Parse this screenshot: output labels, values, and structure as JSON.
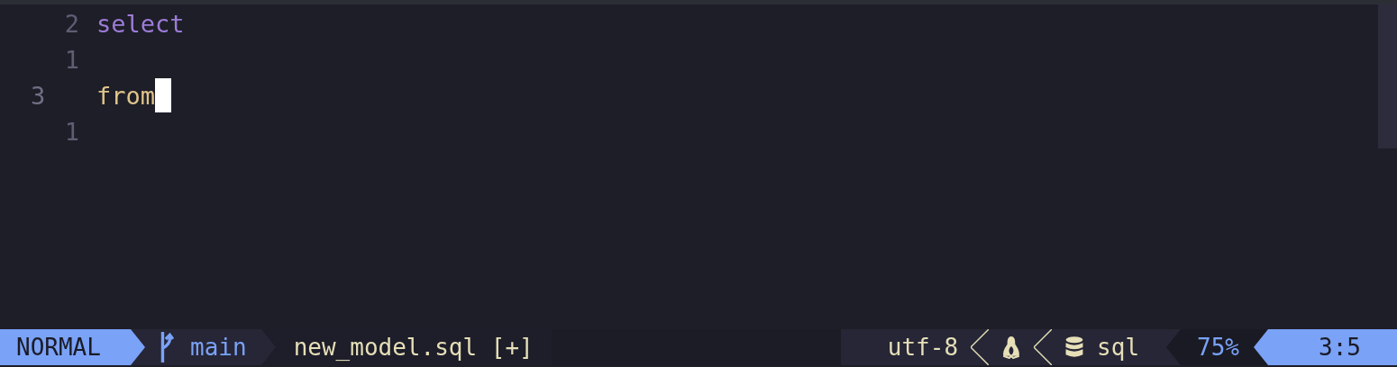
{
  "editor": {
    "lines": [
      {
        "number": "2",
        "text": "select",
        "current": false,
        "cursor": false,
        "kind": "keyword-purple"
      },
      {
        "number": "1",
        "current": false,
        "cursor": false
      },
      {
        "number": "3",
        "text": "from",
        "current": true,
        "cursor": true,
        "kind": "keyword-yellow"
      },
      {
        "number": "1",
        "current": false,
        "cursor": false
      }
    ]
  },
  "status_bar": {
    "mode": "NORMAL",
    "branch": "main",
    "filename": "new_model.sql [+]",
    "encoding": "utf-8",
    "filetype": "sql",
    "progress": "75%",
    "position": "3:5"
  }
}
